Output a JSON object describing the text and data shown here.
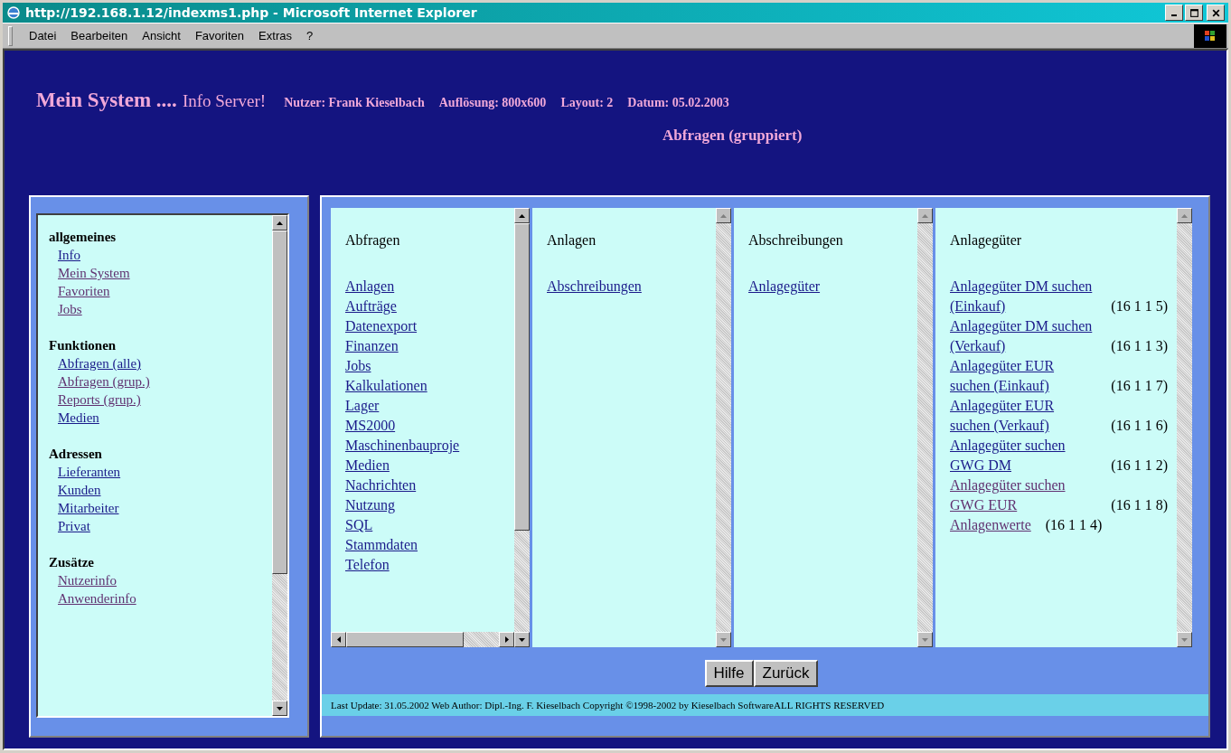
{
  "window": {
    "title": "http://192.168.1.12/indexms1.php - Microsoft Internet Explorer"
  },
  "menu": [
    "Datei",
    "Bearbeiten",
    "Ansicht",
    "Favoriten",
    "Extras",
    "?"
  ],
  "header": {
    "brand": "Mein System ....",
    "brand_suffix": "Info Server!",
    "info": [
      "Nutzer: Frank Kieselbach",
      "Auflösung: 800x600",
      "Layout: 2",
      "Datum: 05.02.2003"
    ],
    "page_title": "Abfragen (gruppiert)"
  },
  "sidebar": [
    {
      "heading": "allgemeines",
      "items": [
        {
          "label": "Info",
          "visited": false
        },
        {
          "label": "Mein System",
          "visited": true
        },
        {
          "label": "Favoriten",
          "visited": true
        },
        {
          "label": "Jobs",
          "visited": true
        }
      ]
    },
    {
      "heading": "Funktionen",
      "items": [
        {
          "label": "Abfragen (alle)",
          "visited": false
        },
        {
          "label": "Abfragen (grup.)",
          "visited": true
        },
        {
          "label": "Reports (grup.)",
          "visited": true
        },
        {
          "label": "Medien",
          "visited": false
        }
      ]
    },
    {
      "heading": "Adressen",
      "items": [
        {
          "label": "Lieferanten",
          "visited": false
        },
        {
          "label": "Kunden",
          "visited": false
        },
        {
          "label": "Mitarbeiter",
          "visited": false
        },
        {
          "label": "Privat",
          "visited": false
        }
      ]
    },
    {
      "heading": "Zusätze",
      "items": [
        {
          "label": "Nutzerinfo",
          "visited": true
        },
        {
          "label": "Anwenderinfo",
          "visited": true
        }
      ]
    }
  ],
  "columns": [
    {
      "heading": "Abfragen",
      "items": [
        {
          "label": "Anlagen",
          "visited": false
        },
        {
          "label": "Aufträge",
          "visited": false
        },
        {
          "label": "Datenexport",
          "visited": false
        },
        {
          "label": "Finanzen",
          "visited": false
        },
        {
          "label": "Jobs",
          "visited": false
        },
        {
          "label": "Kalkulationen",
          "visited": false
        },
        {
          "label": "Lager",
          "visited": false
        },
        {
          "label": "MS2000",
          "visited": false
        },
        {
          "label": "Maschinenbauproje",
          "visited": false
        },
        {
          "label": "Medien",
          "visited": false
        },
        {
          "label": "Nachrichten",
          "visited": false
        },
        {
          "label": "Nutzung",
          "visited": false
        },
        {
          "label": "SQL",
          "visited": false
        },
        {
          "label": "Stammdaten",
          "visited": false
        },
        {
          "label": "Telefon",
          "visited": false
        }
      ]
    },
    {
      "heading": "Anlagen",
      "items": [
        {
          "label": "Abschreibungen",
          "visited": false
        }
      ]
    },
    {
      "heading": "Abschreibungen",
      "items": [
        {
          "label": "Anlagegüter",
          "visited": false
        }
      ]
    },
    {
      "heading": "Anlagegüter",
      "items": [
        {
          "label": "Anlagegüter DM suchen (Einkauf)",
          "code": "(16 1 1 5)",
          "visited": false
        },
        {
          "label": "Anlagegüter DM suchen (Verkauf)",
          "code": "(16 1 1 3)",
          "visited": false
        },
        {
          "label": "Anlagegüter EUR suchen (Einkauf)",
          "code": "(16 1 1 7)",
          "visited": false
        },
        {
          "label": "Anlagegüter EUR suchen (Verkauf)",
          "code": "(16 1 1 6)",
          "visited": false
        },
        {
          "label": "Anlagegüter suchen GWG DM",
          "code": "(16 1 1 2)",
          "visited": false
        },
        {
          "label": "Anlagegüter suchen GWG EUR",
          "code": "(16 1 1 8)",
          "visited": true
        },
        {
          "label": "Anlagenwerte",
          "code": "(16 1 1 4)",
          "visited": true
        }
      ]
    }
  ],
  "buttons": [
    "Hilfe",
    "Zurück"
  ],
  "footer": "Last Update: 31.05.2002 Web Author: Dipl.-Ing. F. Kieselbach Copyright ©1998-2002 by Kieselbach SoftwareALL RIGHTS RESERVED"
}
